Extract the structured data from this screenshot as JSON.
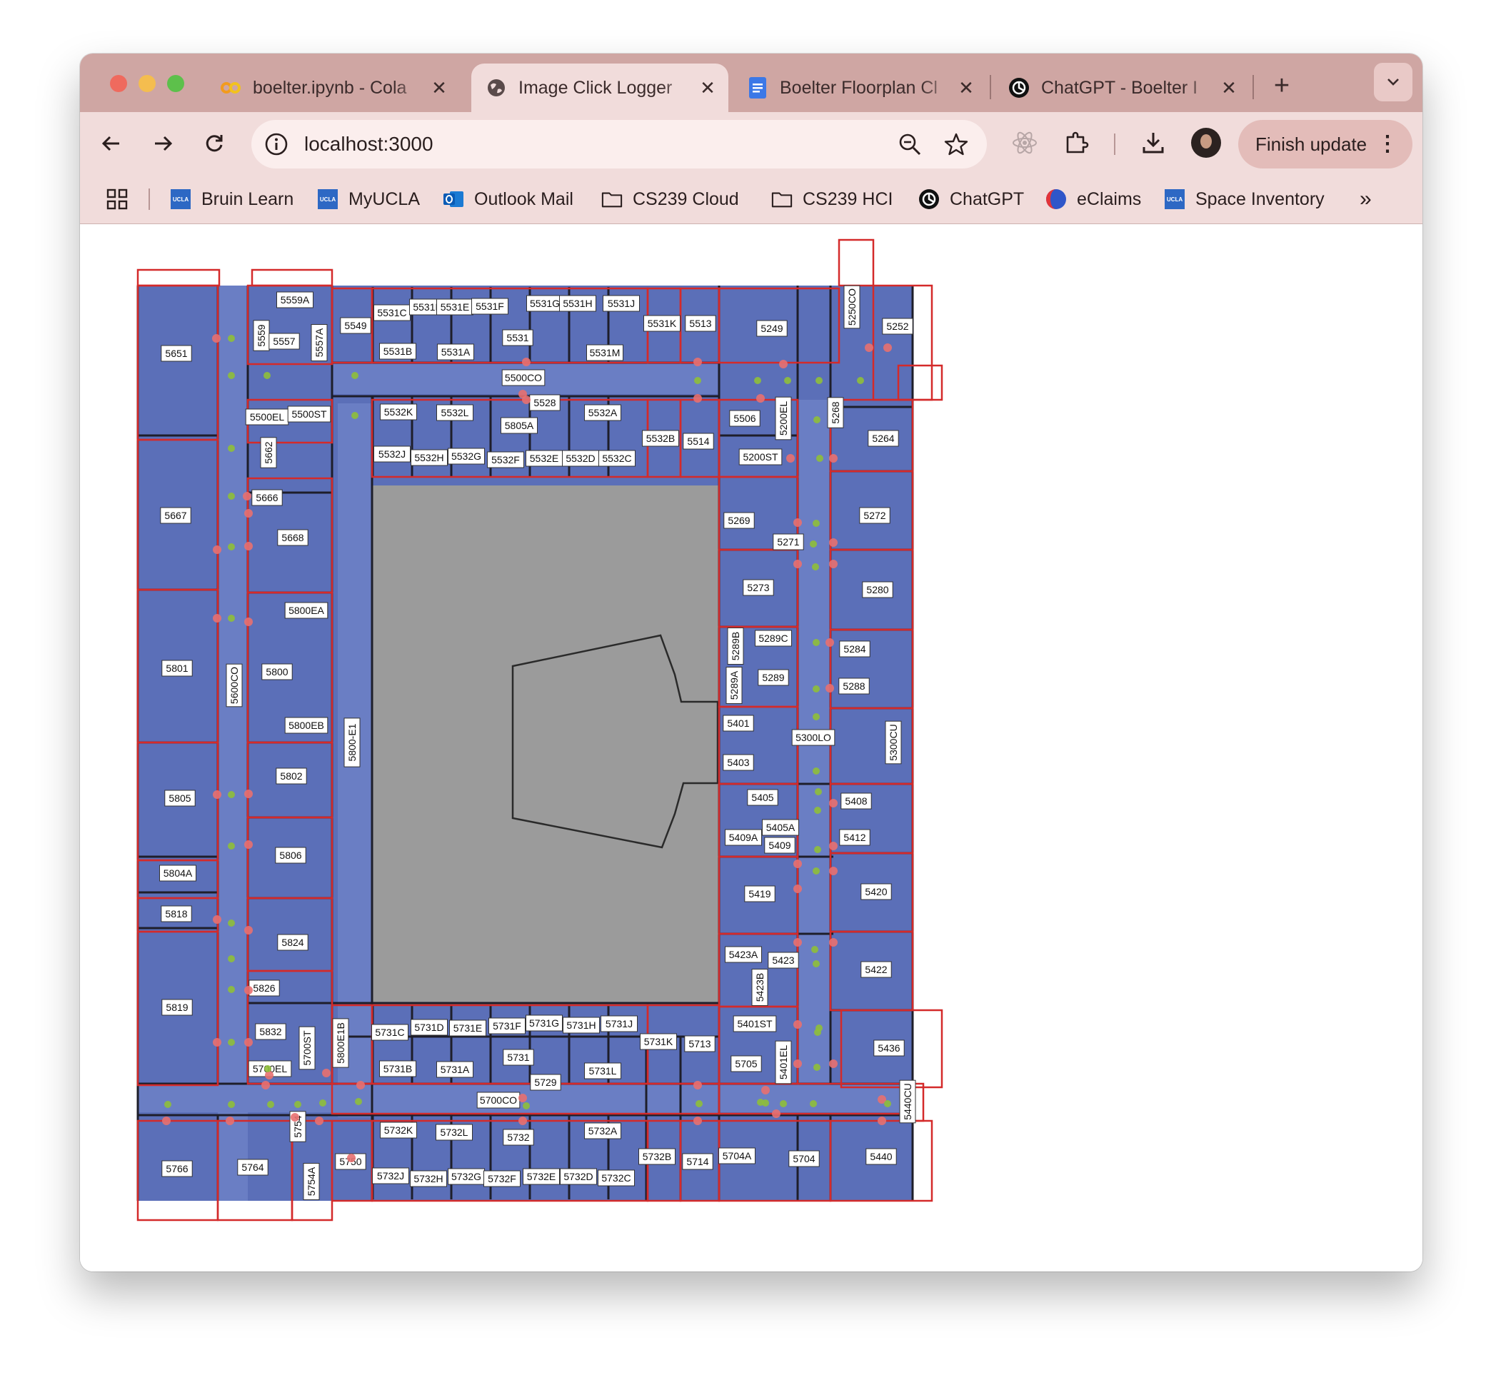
{
  "window": {
    "tabs": [
      {
        "title": "boelter.ipynb - Cola",
        "icon": "colab-icon"
      },
      {
        "title": "Image Click Logger",
        "icon": "globe-icon",
        "active": true
      },
      {
        "title": "Boelter Floorplan Cl",
        "icon": "google-docs-icon"
      },
      {
        "title": "ChatGPT - Boelter I",
        "icon": "chatgpt-icon"
      }
    ]
  },
  "toolbar": {
    "url": "localhost:3000",
    "update_label": "Finish update"
  },
  "bookmarks": [
    {
      "label": "Bruin Learn",
      "icon": "ucla-icon"
    },
    {
      "label": "MyUCLA",
      "icon": "ucla-icon"
    },
    {
      "label": "Outlook Mail",
      "icon": "outlook-icon"
    },
    {
      "label": "CS239 Cloud",
      "icon": "folder-icon"
    },
    {
      "label": "CS239 HCI",
      "icon": "folder-icon"
    },
    {
      "label": "ChatGPT",
      "icon": "chatgpt-icon"
    },
    {
      "label": "eClaims",
      "icon": "eclaims-icon"
    },
    {
      "label": "Space Inventory",
      "icon": "ucla-icon"
    }
  ],
  "floorplan": {
    "colors": {
      "room": "#5b6fb8",
      "courtyard": "#9b9b9b",
      "box": "#d42a2a",
      "wall": "#1e1e2a",
      "marker": "#e87070",
      "marker_alt": "#8fbf3a"
    },
    "room_labels": [
      "5559A",
      "5559",
      "5557",
      "5557A",
      "5549",
      "5531C",
      "5531D",
      "5531E",
      "5531F",
      "5531G",
      "5531H",
      "5531J",
      "5531K",
      "5513",
      "5249",
      "5250CO",
      "5252",
      "5531",
      "5531B",
      "5531A",
      "5531M",
      "5500CO",
      "5528",
      "5532K",
      "5532L",
      "5532A",
      "5805A",
      "5532B",
      "5514",
      "5506",
      "5200EL",
      "5268",
      "5264",
      "5532J",
      "5532H",
      "5532G",
      "5532F",
      "5532E",
      "5532D",
      "5532C",
      "5200ST",
      "5651",
      "5500EL",
      "5500ST",
      "5662",
      "5800EA",
      "5666",
      "5667",
      "5668",
      "5269",
      "5272",
      "5271",
      "5273",
      "5280",
      "5289B",
      "5289C",
      "5284",
      "5289A",
      "5289",
      "5288",
      "5800EA",
      "5800",
      "5801",
      "5600CO",
      "5800EB",
      "5401",
      "5300LO",
      "5300CU",
      "5403",
      "5800-E1",
      "5802",
      "5805",
      "5405",
      "5408",
      "5405A",
      "5409A",
      "5409",
      "5412",
      "5806",
      "5804A",
      "5419",
      "5420",
      "5818",
      "5824",
      "5423A",
      "5423",
      "5422",
      "5423B",
      "5826",
      "5819",
      "5832",
      "5700ST",
      "5800E1B",
      "5401ST",
      "5436",
      "5700EL",
      "5731C",
      "5731D",
      "5731E",
      "5731F",
      "5731G",
      "5731H",
      "5731J",
      "5731K",
      "5713",
      "5705",
      "5401EL",
      "5731",
      "5731B",
      "5731A",
      "5729",
      "5731L",
      "5700CO",
      "5440CU",
      "5754",
      "5732K",
      "5732L",
      "5732",
      "5732A",
      "5750",
      "5732B",
      "5714",
      "5704A",
      "5704",
      "5440",
      "5766",
      "5764",
      "5754A",
      "5732J",
      "5732H",
      "5732G",
      "5732F",
      "5732E",
      "5732D",
      "5732C"
    ]
  }
}
